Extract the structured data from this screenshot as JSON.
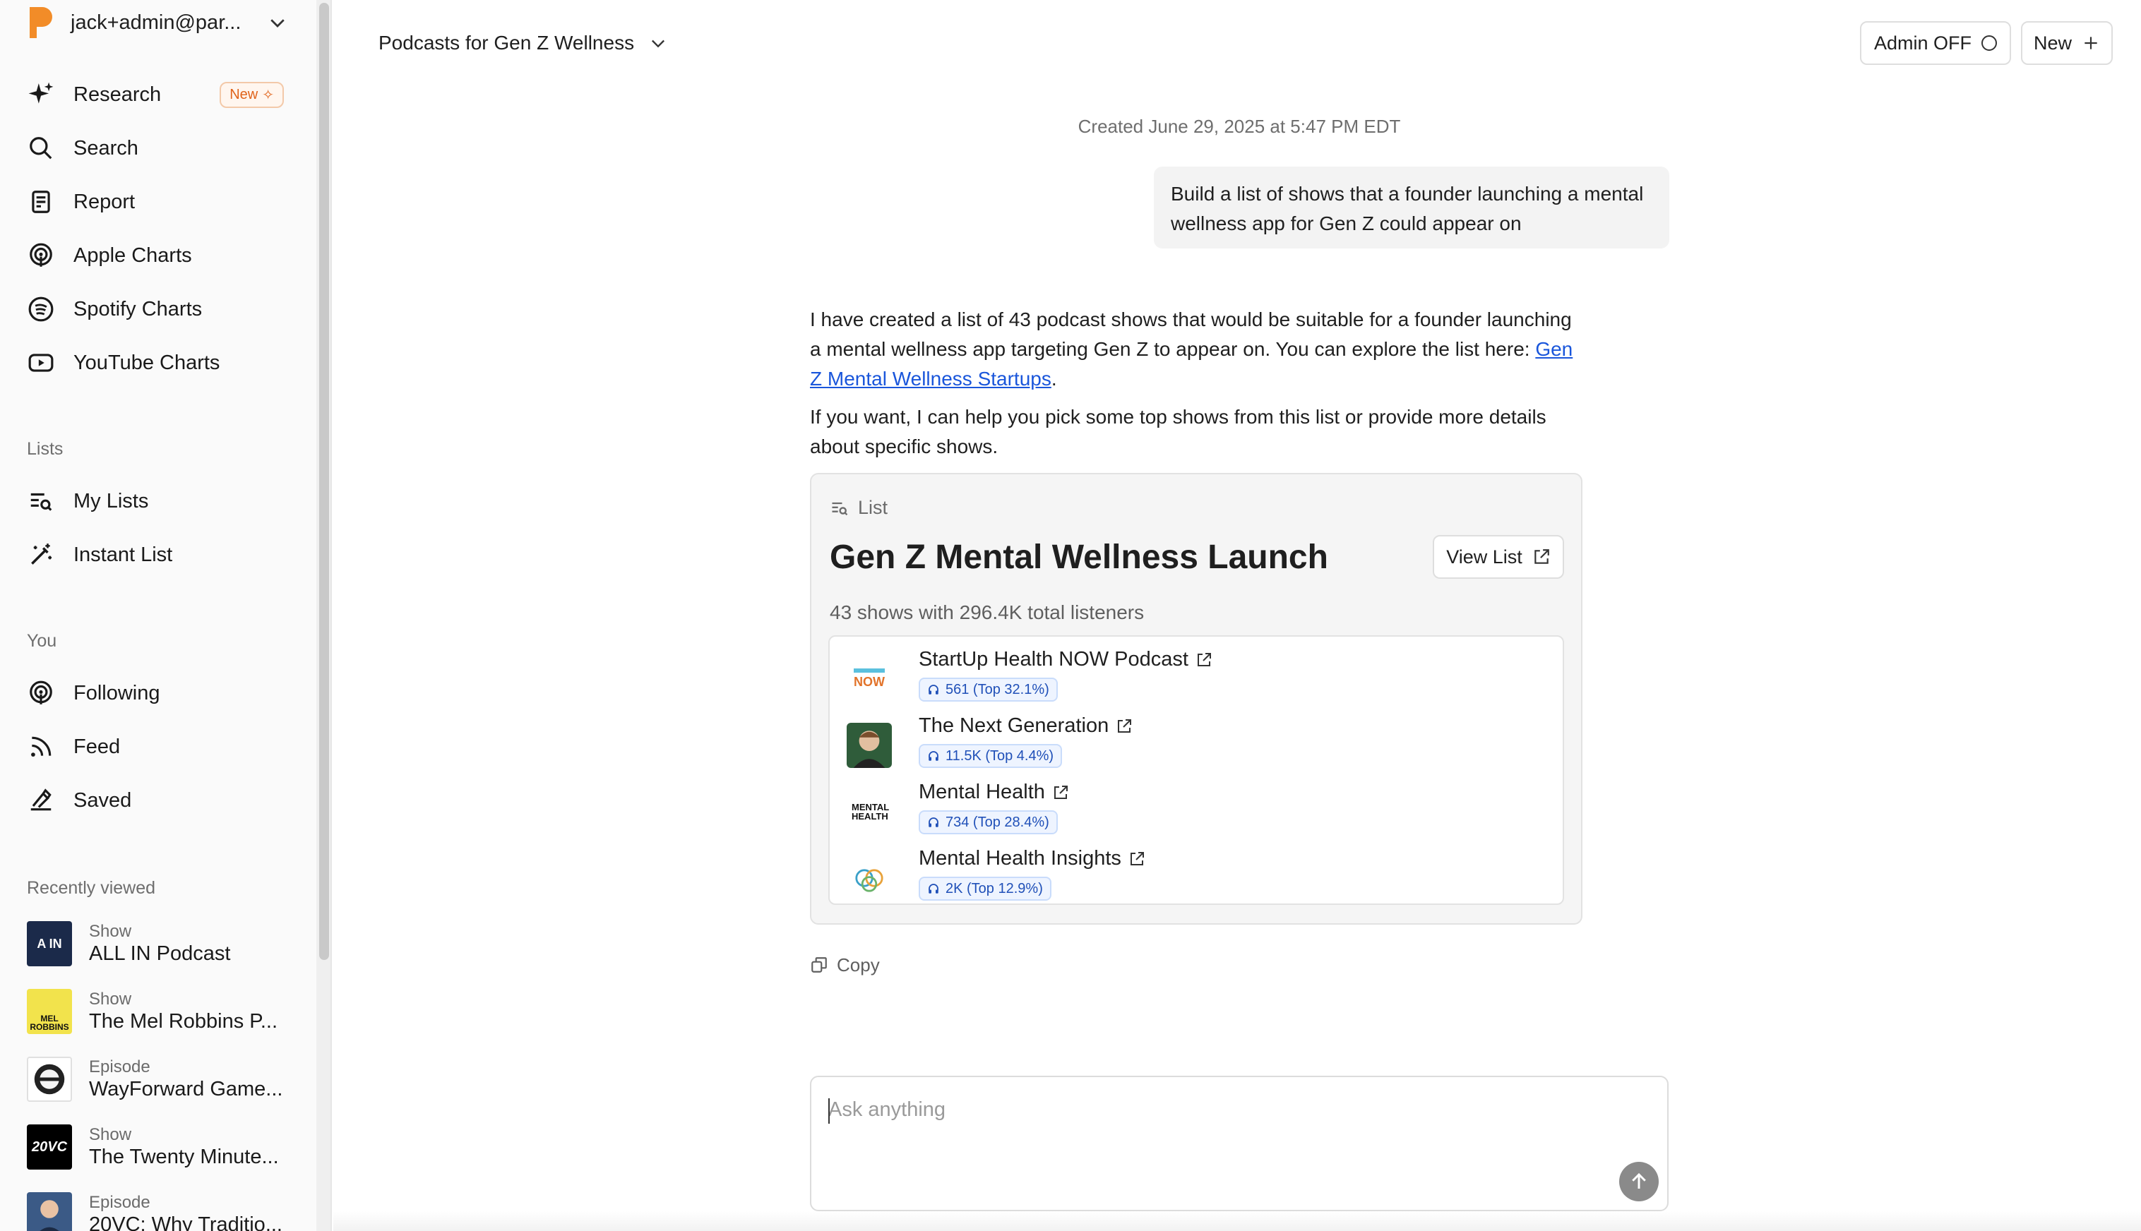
{
  "account": {
    "email": "jack+admin@par...",
    "logo_color": "#f28c28"
  },
  "nav": [
    {
      "label": "Research",
      "icon": "sparkle-icon",
      "badge": "New"
    },
    {
      "label": "Search",
      "icon": "search-icon"
    },
    {
      "label": "Report",
      "icon": "report-icon"
    },
    {
      "label": "Apple Charts",
      "icon": "podcast-icon"
    },
    {
      "label": "Spotify Charts",
      "icon": "spotify-icon"
    },
    {
      "label": "YouTube Charts",
      "icon": "youtube-icon"
    }
  ],
  "lists_section": {
    "label": "Lists",
    "items": [
      {
        "label": "My Lists",
        "icon": "list-search-icon"
      },
      {
        "label": "Instant List",
        "icon": "magic-wand-icon"
      }
    ]
  },
  "you_section": {
    "label": "You",
    "items": [
      {
        "label": "Following",
        "icon": "podcast-icon"
      },
      {
        "label": "Feed",
        "icon": "rss-icon"
      },
      {
        "label": "Saved",
        "icon": "bookmark-hand-icon"
      }
    ]
  },
  "recent_section": {
    "label": "Recently viewed",
    "items": [
      {
        "type": "Show",
        "title": "ALL IN Podcast"
      },
      {
        "type": "Show",
        "title": "The Mel Robbins P..."
      },
      {
        "type": "Episode",
        "title": "WayForward Game..."
      },
      {
        "type": "Show",
        "title": "The Twenty Minute..."
      },
      {
        "type": "Episode",
        "title": "20VC: Why Traditio..."
      }
    ]
  },
  "header": {
    "chat_title": "Podcasts for Gen Z Wellness",
    "admin_label": "Admin OFF",
    "new_label": "New"
  },
  "conversation": {
    "created": "Created June 29, 2025 at 5:47 PM EDT",
    "user_message": "Build a list of shows that a founder launching a mental wellness app for Gen Z could appear on",
    "assistant_p1_before": "I have created a list of 43 podcast shows that would be suitable for a founder launching a mental wellness app targeting Gen Z to appear on. You can explore the list here: ",
    "assistant_p1_link": "Gen Z Mental Wellness Startups",
    "assistant_p1_after": ".",
    "assistant_p2": "If you want, I can help you pick some top shows from this list or provide more details about specific shows.",
    "copy_label": "Copy"
  },
  "list_card": {
    "kind": "List",
    "name": "Gen Z Mental Wellness Launch",
    "view_label": "View List",
    "summary": "43 shows with 296.4K total listeners",
    "shows": [
      {
        "title": "StartUp Health NOW Podcast",
        "stat": "561 (Top 32.1%)"
      },
      {
        "title": "The Next Generation",
        "stat": "11.5K (Top 4.4%)"
      },
      {
        "title": "Mental Health",
        "stat": "734 (Top 28.4%)"
      },
      {
        "title": "Mental Health Insights",
        "stat": "2K (Top 12.9%)"
      }
    ]
  },
  "composer": {
    "placeholder": "Ask anything"
  },
  "artwork_text": {
    "allin": "A IN",
    "mel": "MEL ROBBINS",
    "twentyvc": "20VC",
    "startup": "NOW",
    "mental": "MENTAL HEALTH"
  }
}
